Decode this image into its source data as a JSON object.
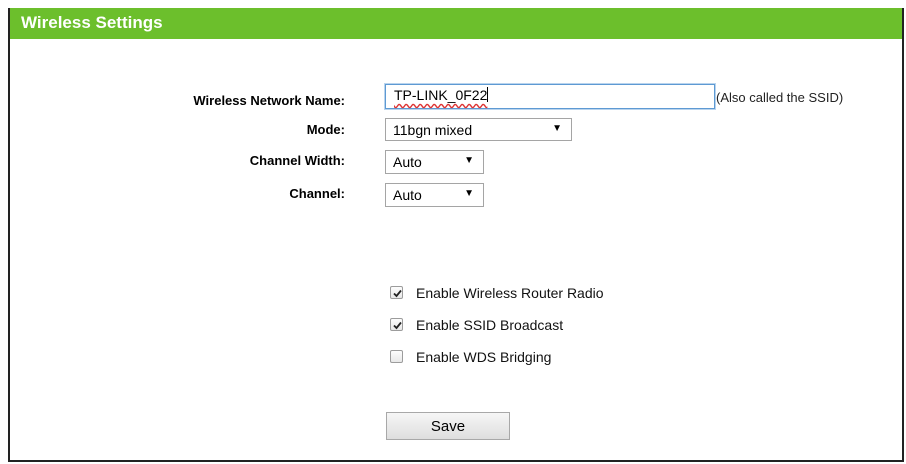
{
  "header": {
    "title": "Wireless Settings"
  },
  "form": {
    "ssid": {
      "label": "Wireless Network Name:",
      "value": "TP-LINK_0F22",
      "hint": "(Also called the SSID)"
    },
    "mode": {
      "label": "Mode:",
      "value": "11bgn mixed"
    },
    "channel_width": {
      "label": "Channel Width:",
      "value": "Auto"
    },
    "channel": {
      "label": "Channel:",
      "value": "Auto"
    }
  },
  "options": {
    "radio": {
      "label": "Enable Wireless Router Radio",
      "checked": true
    },
    "ssid_broadcast": {
      "label": "Enable SSID Broadcast",
      "checked": true
    },
    "wds": {
      "label": "Enable WDS Bridging",
      "checked": false
    }
  },
  "actions": {
    "save_label": "Save"
  },
  "colors": {
    "header_bg": "#6cbf2c",
    "header_text": "#ffffff"
  },
  "icons": {
    "dropdown": "caret-down-icon",
    "check": "checkmark-icon"
  }
}
